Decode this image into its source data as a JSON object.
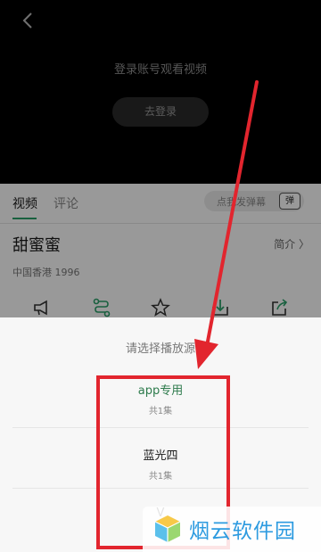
{
  "player": {
    "login_prompt": "登录账号观看视频",
    "login_button": "去登录"
  },
  "detail": {
    "tabs": [
      {
        "label": "视频",
        "active": true
      },
      {
        "label": "评论",
        "active": false
      }
    ],
    "danmu_placeholder": "点我发弹幕",
    "danmu_toggle": "弹",
    "title": "甜蜜蜜",
    "intro_link": "简介 〉",
    "meta": "中国香港  1996",
    "actions": [
      "megaphone-icon",
      "share-route-icon",
      "star-icon",
      "download-icon",
      "share-out-icon"
    ]
  },
  "sheet": {
    "title": "请选择播放源",
    "sources": [
      {
        "name": "app专用",
        "count": "共1集",
        "selected": true
      },
      {
        "name": "蓝光四",
        "count": "共1集",
        "selected": false
      },
      {
        "name": "V",
        "count": "",
        "selected": false
      }
    ]
  },
  "watermark": {
    "text": "烟云软件园"
  },
  "colors": {
    "accent": "#2aa06a",
    "annotation": "#e2252e",
    "watermark": "#2d9be0"
  }
}
